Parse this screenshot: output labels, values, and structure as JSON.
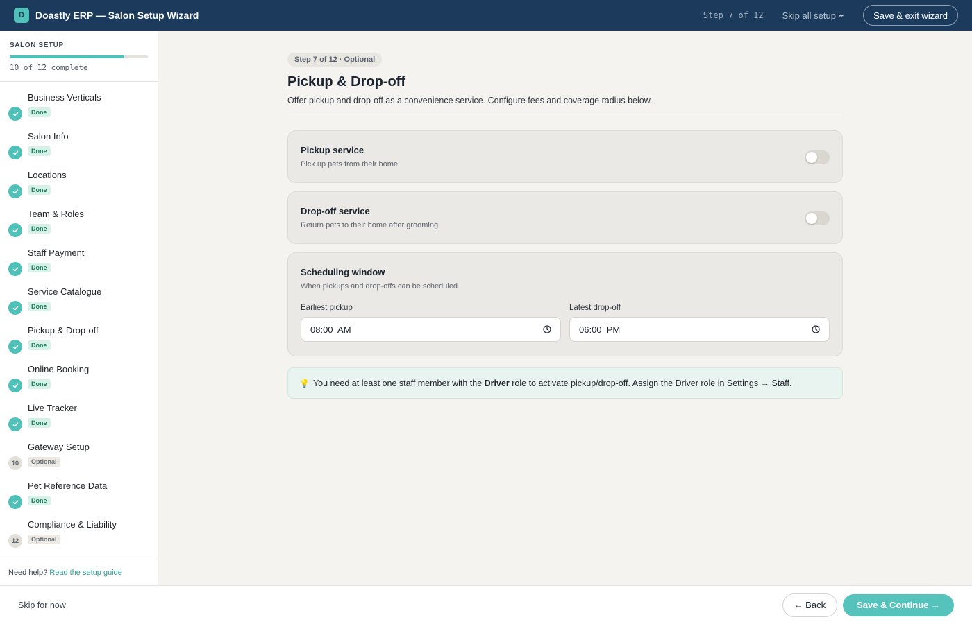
{
  "topbar": {
    "logo_letter": "D",
    "title": "Doastly ERP — Salon Setup Wizard",
    "step_counter": "Step 7 of 12",
    "skip_all_label": "Skip all setup",
    "skip_all_icon": "⏭",
    "exit_label": "Save & exit wizard"
  },
  "sidebar": {
    "title": "SALON SETUP",
    "progress_fraction": 0.83,
    "progress_text": "10 of 12 complete",
    "steps": [
      {
        "label": "Business Verticals",
        "status": "Done",
        "marker": "check"
      },
      {
        "label": "Salon Info",
        "status": "Done",
        "marker": "check"
      },
      {
        "label": "Locations",
        "status": "Done",
        "marker": "check"
      },
      {
        "label": "Team & Roles",
        "status": "Done",
        "marker": "check"
      },
      {
        "label": "Staff Payment",
        "status": "Done",
        "marker": "check"
      },
      {
        "label": "Service Catalogue",
        "status": "Done",
        "marker": "check"
      },
      {
        "label": "Pickup & Drop-off",
        "status": "Done",
        "marker": "check"
      },
      {
        "label": "Online Booking",
        "status": "Done",
        "marker": "check"
      },
      {
        "label": "Live Tracker",
        "status": "Done",
        "marker": "check"
      },
      {
        "label": "Gateway Setup",
        "status": "Optional",
        "marker": "10"
      },
      {
        "label": "Pet Reference Data",
        "status": "Done",
        "marker": "check"
      },
      {
        "label": "Compliance & Liability",
        "status": "Optional",
        "marker": "12"
      }
    ],
    "help_text": "Need help?",
    "help_link": "Read the setup guide"
  },
  "main": {
    "step_pill": "Step 7 of 12 · Optional",
    "title": "Pickup & Drop-off",
    "description": "Offer pickup and drop-off as a convenience service. Configure fees and coverage radius below.",
    "pickup": {
      "title": "Pickup service",
      "subtitle": "Pick up pets from their home",
      "enabled": false
    },
    "dropoff": {
      "title": "Drop-off service",
      "subtitle": "Return pets to their home after grooming",
      "enabled": false
    },
    "schedule": {
      "title": "Scheduling window",
      "subtitle": "When pickups and drop-offs can be scheduled",
      "earliest_label": "Earliest pickup",
      "earliest_value": "08:00  AM",
      "latest_label": "Latest drop-off",
      "latest_value": "06:00  PM"
    },
    "note": {
      "icon": "💡",
      "before": "You need at least one staff member with the ",
      "bold": "Driver",
      "after": " role to activate pickup/drop-off. Assign the Driver role in Settings → Staff."
    }
  },
  "footer": {
    "skip_label": "Skip for now",
    "back_label": "← Back",
    "continue_label": "Save & Continue →"
  },
  "colors": {
    "topbar": "#1b3a5c",
    "accent": "#4fc1b8",
    "done_badge_bg": "#d6f1e8",
    "done_badge_text": "#1b7d5e"
  }
}
